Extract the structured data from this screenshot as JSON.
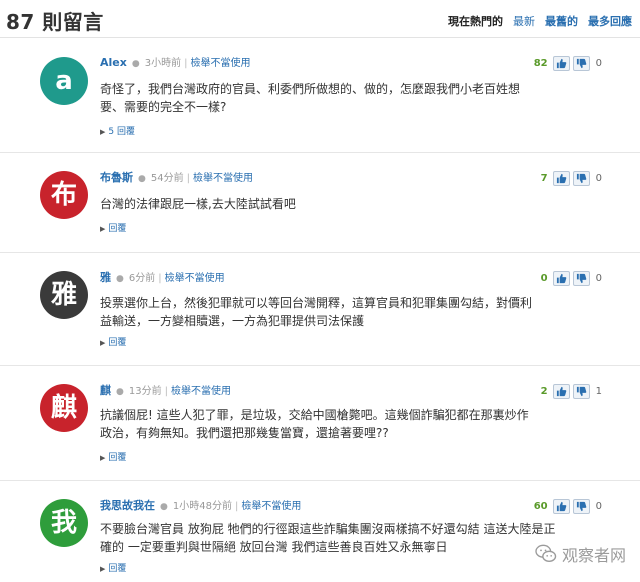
{
  "header": {
    "title": "87 則留言",
    "tabs": [
      {
        "label": "現在熱門的"
      },
      {
        "label": "最新"
      },
      {
        "label": "最舊的"
      },
      {
        "label": "最多回應"
      }
    ]
  },
  "colors": {
    "accent_link": "#2a6fb0",
    "avatar_a": "#1f9a8c",
    "avatar_bu": "#c8232c",
    "avatar_ya": "#3a3a3a",
    "avatar_qi": "#c8232c",
    "avatar_wo": "#2e9d3b"
  },
  "icons": {
    "thumb_up": "thumb-up-icon",
    "thumb_down": "thumb-down-icon",
    "reply_triangle": "triangle-right-icon"
  },
  "report_label": "檢舉不當使用",
  "comments": [
    {
      "avatar_char": "a",
      "author": "Alex",
      "time": "3小時前",
      "text": "奇怪了，我們台灣政府的官員、利委們所做想的、做的，怎麼跟我們小老百姓想要、需要的完全不一樣?",
      "reply_label": "5 回覆",
      "up": "82",
      "down": "0"
    },
    {
      "avatar_char": "布",
      "author": "布魯斯",
      "time": "54分前",
      "text": "台灣的法律跟屁一樣,去大陸試試看吧",
      "reply_label": "回覆",
      "up": "7",
      "down": "0"
    },
    {
      "avatar_char": "雅",
      "author": "雅",
      "time": "6分前",
      "text": "投票選你上台，然後犯罪就可以等回台灣開釋，這算官員和犯罪集團勾結，對價利益輸送，一方變相贖選，一方為犯罪提供司法保護",
      "reply_label": "回覆",
      "up": "0",
      "down": "0"
    },
    {
      "avatar_char": "麒",
      "author": "麒",
      "time": "13分前",
      "text": "抗議個屁!  這些人犯了罪，是垃圾，交給中國槍斃吧。這幾個詐騙犯都在那裏炒作政治，有夠無知。我們還把那幾隻當寶，還搶著要哩??",
      "reply_label": "回覆",
      "up": "2",
      "down": "1"
    },
    {
      "avatar_char": "我",
      "author": "我思故我在",
      "time": "1小時48分前",
      "text": "不要臉台灣官員 放狗屁 牠們的行徑跟這些詐騙集團沒兩樣搞不好還勾結 這送大陸是正確的 一定要重判與世隔絕 放回台灣 我們這些善良百姓又永無寧日",
      "reply_label": "回覆",
      "up": "60",
      "down": "0"
    }
  ],
  "watermark": {
    "text": "观察者网"
  }
}
